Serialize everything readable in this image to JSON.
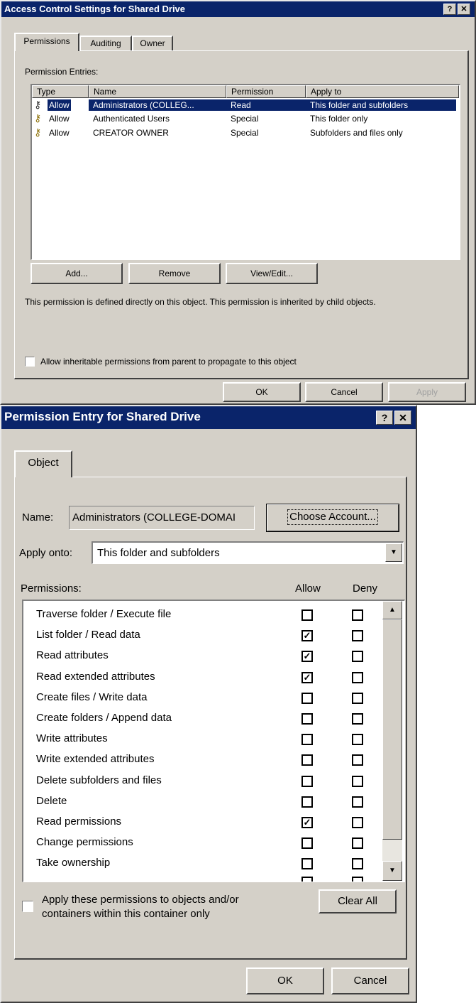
{
  "acl_dialog": {
    "title": "Access Control Settings for Shared Drive",
    "help_btn": "?",
    "close_btn": "✕",
    "tabs": [
      "Permissions",
      "Auditing",
      "Owner"
    ],
    "entries_label": "Permission Entries:",
    "columns": [
      "Type",
      "Name",
      "Permission",
      "Apply to"
    ],
    "rows": [
      {
        "type": "Allow",
        "name": "Administrators (COLLEG...",
        "permission": "Read",
        "apply_to": "This folder and subfolders"
      },
      {
        "type": "Allow",
        "name": "Authenticated Users",
        "permission": "Special",
        "apply_to": "This folder only"
      },
      {
        "type": "Allow",
        "name": "CREATOR OWNER",
        "permission": "Special",
        "apply_to": "Subfolders and files only"
      }
    ],
    "add_btn": "Add...",
    "remove_btn": "Remove",
    "view_edit_btn": "View/Edit...",
    "info_text": "This permission is defined directly on this object.  This permission is inherited by child objects.",
    "inherit_label": "Allow inheritable permissions from parent to propagate to this object",
    "ok_btn": "OK",
    "cancel_btn": "Cancel",
    "apply_btn": "Apply"
  },
  "entry_dialog": {
    "title": "Permission Entry for Shared Drive",
    "help_btn": "?",
    "close_btn": "✕",
    "tab": "Object",
    "name_label": "Name:",
    "name_value": "Administrators (COLLEGE-DOMAI",
    "choose_btn": "Choose Account...",
    "apply_onto_label": "Apply onto:",
    "apply_onto_value": "This folder and subfolders",
    "permissions_label": "Permissions:",
    "allow_header": "Allow",
    "deny_header": "Deny",
    "permissions": [
      {
        "label": "Traverse folder / Execute file",
        "allow": false,
        "deny": false
      },
      {
        "label": "List folder / Read data",
        "allow": true,
        "deny": false
      },
      {
        "label": "Read attributes",
        "allow": true,
        "deny": false
      },
      {
        "label": "Read extended attributes",
        "allow": true,
        "deny": false
      },
      {
        "label": "Create files / Write data",
        "allow": false,
        "deny": false
      },
      {
        "label": "Create folders / Append data",
        "allow": false,
        "deny": false
      },
      {
        "label": "Write attributes",
        "allow": false,
        "deny": false
      },
      {
        "label": "Write extended attributes",
        "allow": false,
        "deny": false
      },
      {
        "label": "Delete subfolders and files",
        "allow": false,
        "deny": false
      },
      {
        "label": "Delete",
        "allow": false,
        "deny": false
      },
      {
        "label": "Read permissions",
        "allow": true,
        "deny": false
      },
      {
        "label": "Change permissions",
        "allow": false,
        "deny": false
      },
      {
        "label": "Take ownership",
        "allow": false,
        "deny": false
      }
    ],
    "apply_only_label_line1": "Apply these permissions to objects and/or",
    "apply_only_label_line2": "containers within this container only",
    "clear_all_btn": "Clear All",
    "ok_btn": "OK",
    "cancel_btn": "Cancel"
  }
}
